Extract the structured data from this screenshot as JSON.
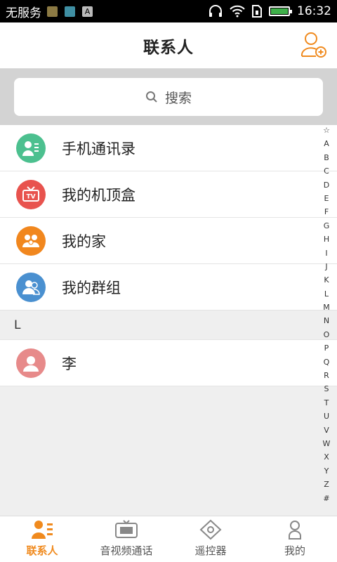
{
  "statusbar": {
    "carrier": "无服务",
    "time": "16:32",
    "icons": [
      "gallery-icon",
      "photo-icon",
      "a-icon",
      "headphones-icon",
      "wifi-icon",
      "sim-icon",
      "battery-icon"
    ]
  },
  "header": {
    "title": "联系人",
    "add_icon": "add-contact-icon"
  },
  "search": {
    "placeholder": "搜索"
  },
  "list": {
    "items": [
      {
        "label": "手机通讯录",
        "icon": "phone-contacts-icon",
        "color": "#4cc08f"
      },
      {
        "label": "我的机顶盒",
        "icon": "set-top-box-icon",
        "color": "#e8534e"
      },
      {
        "label": "我的家",
        "icon": "family-icon",
        "color": "#f1871e"
      },
      {
        "label": "我的群组",
        "icon": "group-icon",
        "color": "#4a90d0"
      }
    ],
    "section": "L",
    "contacts": [
      {
        "label": "李",
        "icon": "person-avatar-icon",
        "color": "#e78a8a"
      }
    ]
  },
  "index_letters": [
    "☆",
    "A",
    "B",
    "C",
    "D",
    "E",
    "F",
    "G",
    "H",
    "I",
    "J",
    "K",
    "L",
    "M",
    "N",
    "O",
    "P",
    "Q",
    "R",
    "S",
    "T",
    "U",
    "V",
    "W",
    "X",
    "Y",
    "Z",
    "#"
  ],
  "nav": {
    "tabs": [
      {
        "label": "联系人",
        "icon": "contacts-icon",
        "active": true
      },
      {
        "label": "音视频通话",
        "icon": "video-call-icon",
        "active": false
      },
      {
        "label": "遥控器",
        "icon": "remote-control-icon",
        "active": false
      },
      {
        "label": "我的",
        "icon": "profile-icon",
        "active": false
      }
    ]
  },
  "colors": {
    "accent": "#f08a1e",
    "search_bg": "#d3d3d3",
    "page_bg": "#efefef"
  }
}
